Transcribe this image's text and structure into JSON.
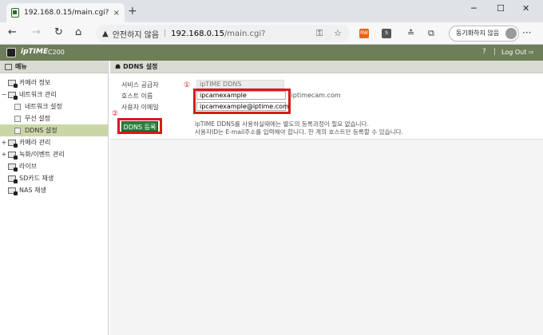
{
  "browser": {
    "tab_title": "192.168.0.15/main.cgi?",
    "tab_close": "×",
    "new_tab": "+",
    "win_min": "─",
    "win_max": "☐",
    "win_close": "✕",
    "back": "←",
    "forward": "→",
    "reload": "↻",
    "home": "⌂",
    "warning": "▲",
    "security_text": "안전하지 않음",
    "separator": "|",
    "url_host": "192.168.0.15",
    "url_path": "/main.cgi?",
    "key_icon": "⚿",
    "star": "☆",
    "ext1": "RW",
    "ext2": "S",
    "favorites": "≛",
    "collections": "⧉",
    "sync_label": "동기화하지 않음",
    "more": "···"
  },
  "app": {
    "logo": "ipTIME",
    "model": "C200",
    "help": "?",
    "divider": "|",
    "logout": "Log Out ⇨"
  },
  "sidebar": {
    "header": "메뉴",
    "items": [
      {
        "label": "카메라 정보",
        "toggle": ""
      },
      {
        "label": "네트워크 관리",
        "toggle": "−"
      },
      {
        "label": "네트워크 설정",
        "toggle": ""
      },
      {
        "label": "무선 설정",
        "toggle": ""
      },
      {
        "label": "DDNS 설정",
        "toggle": ""
      },
      {
        "label": "카메라 관리",
        "toggle": "+"
      },
      {
        "label": "녹화/이벤트 관리",
        "toggle": "+"
      },
      {
        "label": "라이브",
        "toggle": ""
      },
      {
        "label": "SD카드 재생",
        "toggle": ""
      },
      {
        "label": "NAS 재생",
        "toggle": ""
      }
    ]
  },
  "content": {
    "header_icon": "☗",
    "header": "DDNS 설정",
    "service_label": "서비스 공급자",
    "service_value": "ipTIME DDNS",
    "host_label": "호스트 이름",
    "host_value": "ipcamexample",
    "host_suffix": ".iptimecam.com",
    "email_label": "사용자 이메일",
    "email_value": "ipcamexample@iptime.com",
    "marker1": "①",
    "marker2": "②",
    "register_button": "DDNS 등록",
    "info_line1": "ipTIME DDNS를 사용하실때에는 별도의 등록과정이 필요 없습니다.",
    "info_line2": "사용자ID는 E-mail주소를 입력해야 합니다. 한 계의 호스트만 등록할 수 있습니다."
  },
  "colors": {
    "header_green": "#6e7e58",
    "active_item": "#cbd6a6",
    "highlight_red": "#d41c1c",
    "button_green": "#2f7d3a"
  }
}
